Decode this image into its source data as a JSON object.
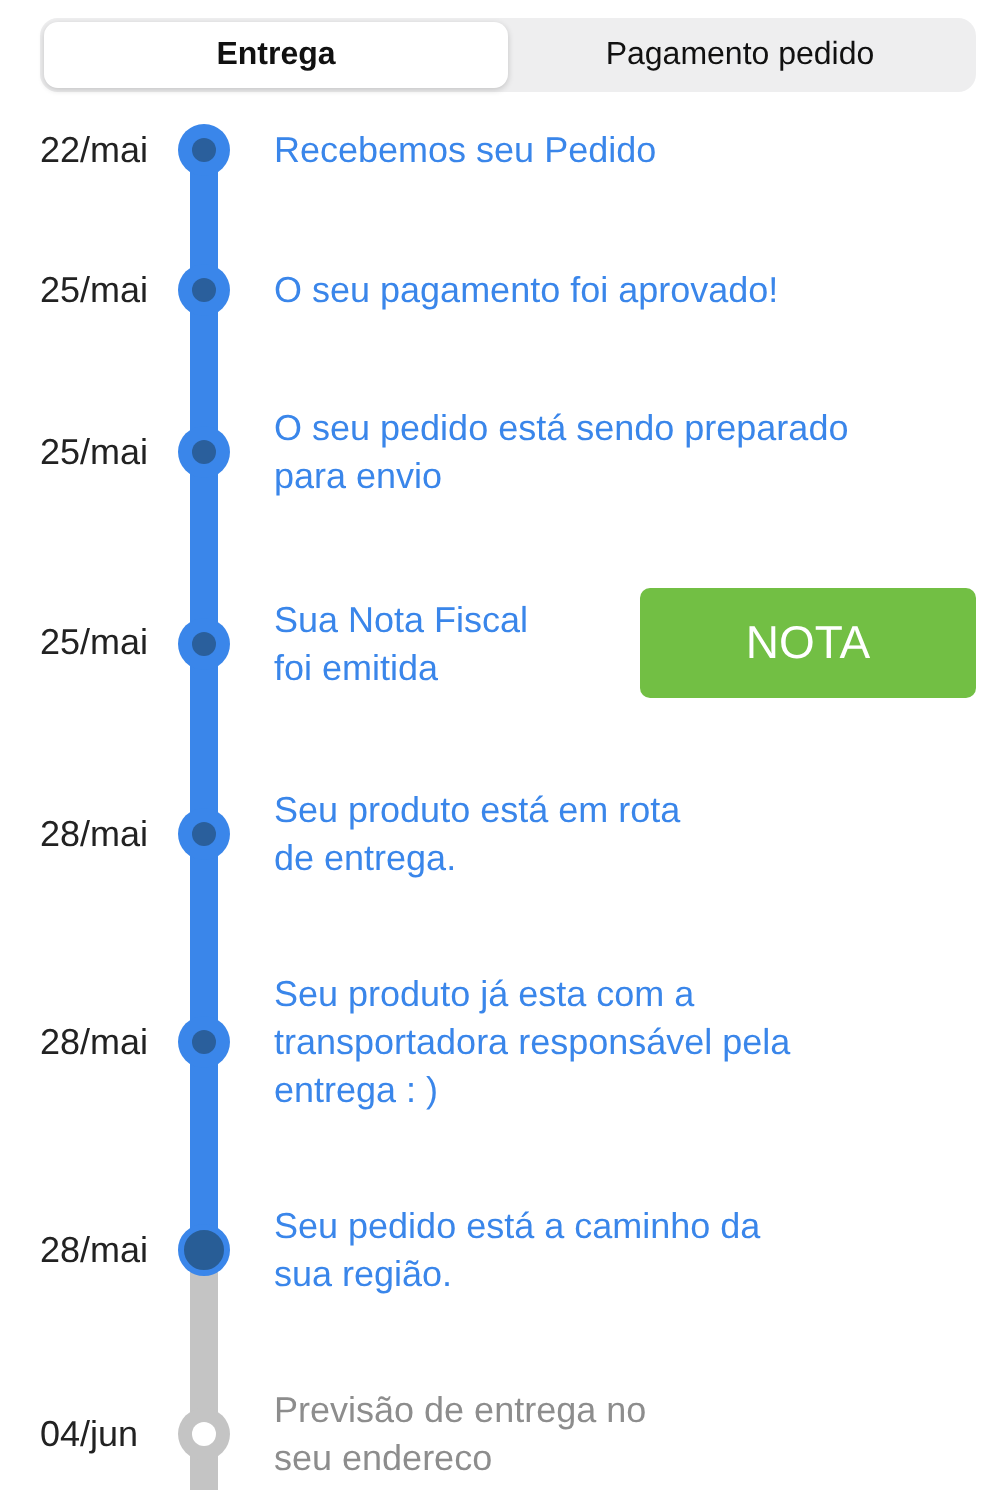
{
  "tabs": [
    {
      "label": "Entrega",
      "selected": true
    },
    {
      "label": "Pagamento pedido",
      "selected": false
    }
  ],
  "events": [
    {
      "date": "22/mai",
      "text": "Recebemos seu Pedido",
      "completed": true,
      "current": false
    },
    {
      "date": "25/mai",
      "text": "O seu pagamento foi aprovado!",
      "completed": true,
      "current": false
    },
    {
      "date": "25/mai",
      "text": "O seu pedido está sendo preparado\npara envio",
      "completed": true,
      "current": false
    },
    {
      "date": "25/mai",
      "text": "Sua Nota Fiscal\nfoi emitida",
      "completed": true,
      "current": false,
      "button": "NOTA"
    },
    {
      "date": "28/mai",
      "text": "Seu produto está em rota\nde entrega.",
      "completed": true,
      "current": false
    },
    {
      "date": "28/mai",
      "text": "Seu produto já esta com a\ntransportadora responsável pela\nentrega : )",
      "completed": true,
      "current": false
    },
    {
      "date": "28/mai",
      "text": "Seu pedido está a caminho da\nsua região.",
      "completed": true,
      "current": true
    },
    {
      "date": "04/jun",
      "text": "Previsão de entrega no\nseu endereco",
      "completed": false,
      "current": false
    }
  ]
}
